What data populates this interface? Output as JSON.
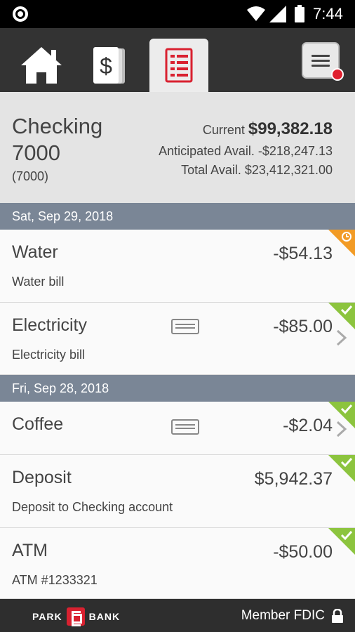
{
  "status_bar": {
    "time": "7:44",
    "icons": [
      "notification-dot-icon",
      "wifi-icon",
      "signal-icon",
      "battery-icon"
    ]
  },
  "nav": {
    "tabs": [
      {
        "name": "home",
        "icon": "home-icon"
      },
      {
        "name": "accounts",
        "icon": "money-icon"
      },
      {
        "name": "transactions",
        "icon": "transactions-icon",
        "active": true
      }
    ],
    "menu_icon": "menu-icon",
    "has_notification": true
  },
  "account": {
    "name": "Checking 7000",
    "number": "(7000)",
    "current_label": "Current",
    "current_amount": "$99,382.18",
    "anticipated": "Anticipated Avail. -$218,247.13",
    "total": "Total Avail. $23,412,321.00"
  },
  "groups": [
    {
      "date": "Sat, Sep 29, 2018",
      "transactions": [
        {
          "title": "Water",
          "subtitle": "Water bill",
          "amount": "-$54.13",
          "status": "pending",
          "card": false,
          "chevron": false
        },
        {
          "title": "Electricity",
          "subtitle": "Electricity bill",
          "amount": "-$85.00",
          "status": "cleared",
          "card": true,
          "chevron": true
        }
      ]
    },
    {
      "date": "Fri, Sep 28, 2018",
      "transactions": [
        {
          "title": "Coffee",
          "subtitle": "",
          "amount": "-$2.04",
          "status": "cleared",
          "card": true,
          "chevron": true
        },
        {
          "title": "Deposit",
          "subtitle": "Deposit to Checking account",
          "amount": "$5,942.37",
          "status": "cleared",
          "card": false,
          "chevron": false
        },
        {
          "title": "ATM",
          "subtitle": "ATM #1233321",
          "amount": "-$50.00",
          "status": "cleared",
          "card": false,
          "chevron": false
        }
      ]
    }
  ],
  "footer": {
    "brand_left": "PARK",
    "brand_right": "BANK",
    "fdic": "Member FDIC"
  },
  "colors": {
    "status_cleared": "#8cc43e",
    "status_pending": "#f29b25",
    "accent": "#d92130",
    "date_header": "#7a8696"
  }
}
